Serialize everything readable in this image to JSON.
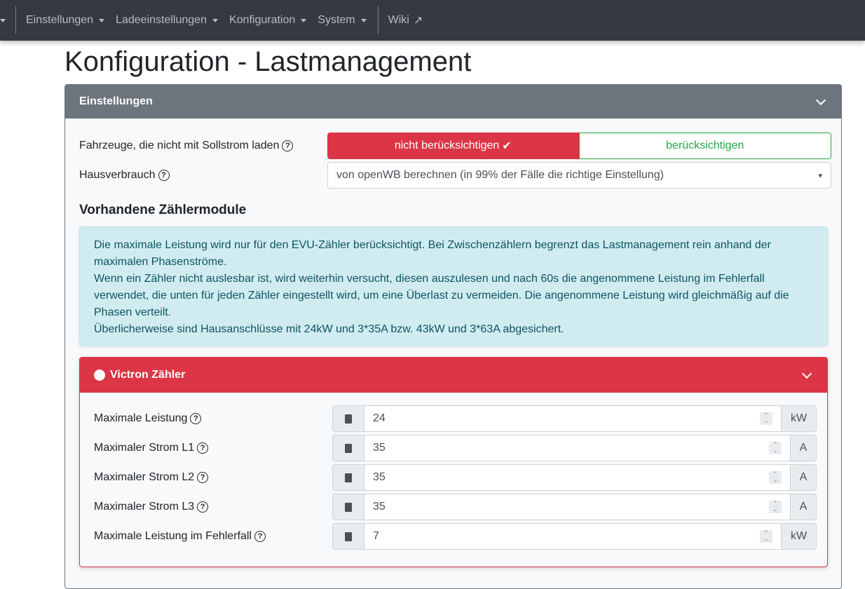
{
  "nav": {
    "items": [
      "Einstellungen",
      "Ladeeinstellungen",
      "Konfiguration",
      "System"
    ],
    "wiki": "Wiki"
  },
  "page_title": "Konfiguration - Lastmanagement",
  "card": {
    "title": "Einstellungen",
    "vehicles_label": "Fahrzeuge, die nicht mit Sollstrom laden",
    "toggle_off": "nicht berücksichtigen",
    "toggle_on": "berücksichtigen",
    "house_label": "Hausverbrauch",
    "house_value": "von openWB berechnen (in 99% der Fälle die richtige Einstellung)",
    "section": "Vorhandene Zählermodule",
    "alert": [
      "Die maximale Leistung wird nur für den EVU-Zähler berücksichtigt. Bei Zwischenzählern begrenzt das Lastmanagement rein anhand der maximalen Phasenströme.",
      "Wenn ein Zähler nicht auslesbar ist, wird weiterhin versucht, diesen auszulesen und nach 60s die angenommene Leistung im Fehlerfall verwendet, die unten für jeden Zähler eingestellt wird, um eine Überlast zu vermeiden. Die angenommene Leistung wird gleichmäßig auf die Phasen verteilt.",
      "Überlicherweise sind Hausanschlüsse mit 24kW und 3*35A bzw. 43kW und 3*63A abgesichert."
    ]
  },
  "meter": {
    "title": "Victron Zähler",
    "fields": [
      {
        "label": "Maximale Leistung",
        "value": "24",
        "unit": "kW"
      },
      {
        "label": "Maximaler Strom L1",
        "value": "35",
        "unit": "A"
      },
      {
        "label": "Maximaler Strom L2",
        "value": "35",
        "unit": "A"
      },
      {
        "label": "Maximaler Strom L3",
        "value": "35",
        "unit": "A"
      },
      {
        "label": "Maximale Leistung im Fehlerfall",
        "value": "7",
        "unit": "kW"
      }
    ]
  }
}
